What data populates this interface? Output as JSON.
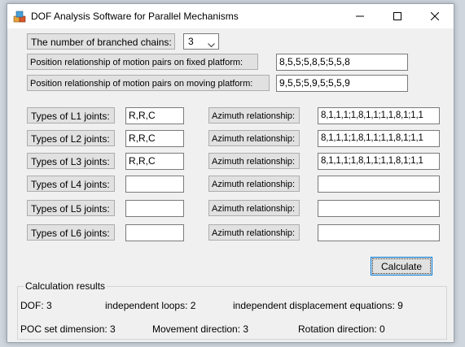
{
  "window": {
    "title": "DOF Analysis Software for Parallel Mechanisms",
    "icon": "app-icon"
  },
  "chains": {
    "label": "The number of branched chains:",
    "selected": "3"
  },
  "fixed_platform": {
    "label": "Position relationship of motion pairs on fixed platform:",
    "value": "8,5,5;5,8,5;5,5,8"
  },
  "moving_platform": {
    "label": "Position relationship of motion pairs on moving platform:",
    "value": "9,5,5;5,9,5;5,5,9"
  },
  "legs": [
    {
      "joints_label": "Types of L1 joints:",
      "joints_value": "R,R,C",
      "azimuth_label": "Azimuth relationship:",
      "azimuth_value": "8,1,1,1;1,8,1,1;1,1,8,1;1,1"
    },
    {
      "joints_label": "Types of L2 joints:",
      "joints_value": "R,R,C",
      "azimuth_label": "Azimuth relationship:",
      "azimuth_value": "8,1,1,1;1,8,1,1;1,1,8,1;1,1"
    },
    {
      "joints_label": "Types of L3 joints:",
      "joints_value": "R,R,C",
      "azimuth_label": "Azimuth relationship:",
      "azimuth_value": "8,1,1,1;1,8,1,1;1,1,8,1;1,1"
    },
    {
      "joints_label": "Types of L4 joints:",
      "joints_value": "",
      "azimuth_label": "Azimuth relationship:",
      "azimuth_value": ""
    },
    {
      "joints_label": "Types of L5 joints:",
      "joints_value": "",
      "azimuth_label": "Azimuth relationship:",
      "azimuth_value": ""
    },
    {
      "joints_label": "Types of L6 joints:",
      "joints_value": "",
      "azimuth_label": "Azimuth relationship:",
      "azimuth_value": ""
    }
  ],
  "calculate_label": "Calculate",
  "results": {
    "title": "Calculation results",
    "dof": "DOF:   3",
    "loops": "independent loops:   2",
    "equations": "independent displacement equations:   9",
    "poc": "POC set dimension:  3",
    "movement": "Movement direction:  3",
    "rotation": "Rotation direction: 0"
  }
}
